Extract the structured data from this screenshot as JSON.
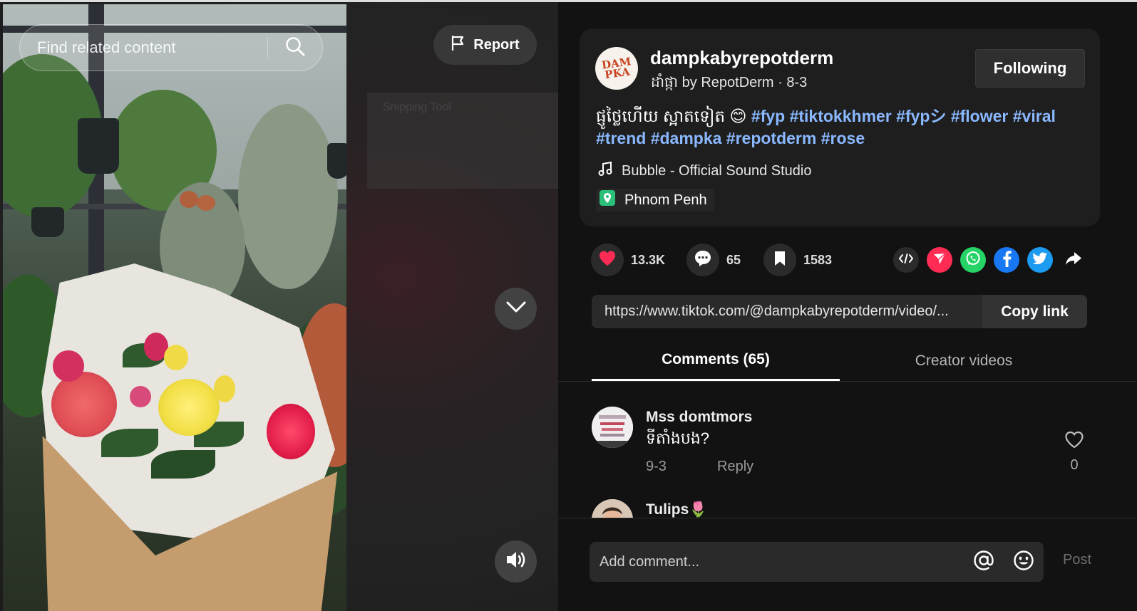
{
  "search": {
    "placeholder": "Find related content"
  },
  "video": {
    "report_label": "Report",
    "overlay_label": "Snipping Tool"
  },
  "creator": {
    "username": "dampkabyrepotderm",
    "avatar_text": "DAM PKA",
    "meta": "ដាំផ្កា by RepotDerm · 8-3",
    "follow_label": "Following"
  },
  "caption": {
    "text": "ផ្ញូថ្លៃហើយ ស្អាតទៀត 😊 ",
    "hashtags": [
      "#fyp",
      "#tiktokkhmer",
      "#fypシ",
      "#flower",
      "#viral",
      "#trend",
      "#dampka",
      "#repotderm",
      "#rose"
    ]
  },
  "music": {
    "label": "Bubble - Official Sound Studio"
  },
  "location": {
    "label": "Phnom Penh"
  },
  "actions": {
    "likes": "13.3K",
    "comments": "65",
    "saves": "1583"
  },
  "share_icons": [
    "embed-icon",
    "send-icon",
    "whatsapp-icon",
    "facebook-icon",
    "twitter-icon",
    "share-arrow-icon"
  ],
  "link": {
    "url": "https://www.tiktok.com/@dampkabyrepotderm/video/...",
    "copy_label": "Copy link"
  },
  "tabs": {
    "comments": "Comments (65)",
    "creator_videos": "Creator videos"
  },
  "comments": [
    {
      "user": "Mss domtmors",
      "text": "ទីតាំងបង?",
      "date": "9-3",
      "reply": "Reply",
      "likes": "0"
    },
    {
      "user": "Tulips🌷",
      "text": "",
      "date": "",
      "reply": "",
      "likes": ""
    }
  ],
  "composer": {
    "placeholder": "Add comment...",
    "post_label": "Post"
  },
  "colors": {
    "panel_bg": "#121212",
    "card_bg": "#1e1e1e",
    "hashtag": "#8ab8ff",
    "like_red": "#fe2c55",
    "whatsapp": "#25d366",
    "facebook": "#1877f2",
    "twitter": "#1d9bf0",
    "location_green": "#2bbf7a"
  }
}
